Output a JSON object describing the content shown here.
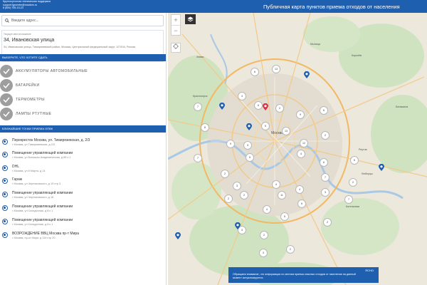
{
  "header": {
    "support_line1": "Круглосуточная техническая поддержка",
    "support_line2": "support.fgrcenter@rosatom.ru",
    "support_line3": "8 (800) 755-15-23",
    "title": "Публичная карта пунктов приема отходов от населения",
    "background": "#1f5fb0"
  },
  "search": {
    "placeholder": "Введите адрес...",
    "value": "",
    "icon": "search-icon"
  },
  "address": {
    "caption": "Текущее местоположение",
    "name": "34, Ивановская улица",
    "full": "34, Ивановская улица, Тимирязевский район, Москва, Центральный федеральный округ, 127434, Россия"
  },
  "waste_section": {
    "title": "ВЫБЕРИТЕ, ЧТО ХОТИТЕ СДАТЬ",
    "items": [
      {
        "label": "АККУМУЛЯТОРЫ АВТОМОБИЛЬНЫЕ",
        "icon": "check-icon"
      },
      {
        "label": "БАТАРЕЙКИ",
        "icon": "check-icon"
      },
      {
        "label": "ТЕРМОМЕТРЫ",
        "icon": "check-icon"
      },
      {
        "label": "ЛАМПЫ РТУТНЫЕ",
        "icon": "check-icon"
      }
    ]
  },
  "points_section": {
    "title": "БЛИЖАЙШИЕ ТОЧКИ ПРИЕМА ОПВК",
    "items": [
      {
        "name": "Перекресток Москва, ул. Тимирязевская, д. 2/3",
        "address": "г Москва, ул Тимирязевская, д 2/3"
      },
      {
        "name": "Помещение управляющей компании",
        "address": "г Москва, ул Большая Академическая, д 85 к 1"
      },
      {
        "name": "DHL",
        "address": "г Москва, ул 8 Марта, д 14"
      },
      {
        "name": "Гараж",
        "address": "г Москва, ул Черняховского, д 19 стр 3"
      },
      {
        "name": "Помещение управляющей компании",
        "address": "г Москва, ул Черняховского, д 16"
      },
      {
        "name": "Помещение управляющей компании",
        "address": "г Москва, ул Складочная, д 8 к 1"
      },
      {
        "name": "Помещение управляющей компании",
        "address": "г Москва, ул Складочная, д 8 к 1"
      },
      {
        "name": "ВОЗРОЖДЕНИЕ ВВЦ Москва пр-т Мира",
        "address": "г Москва, пр-кт Мира, д 119 стр 20"
      }
    ]
  },
  "map": {
    "zoom_in": "+",
    "zoom_out": "−",
    "layers_icon": "layers-icon",
    "locate_icon": "locate-icon",
    "center_label": "Москва",
    "place_labels": [
      "Химки",
      "Мытищи",
      "Королёв",
      "Балашиха",
      "Реутов",
      "Люберцы",
      "Котельники",
      "Красногорск"
    ],
    "clusters": [
      "6",
      "13",
      "4",
      "6",
      "7",
      "2",
      "9",
      "6",
      "2",
      "8",
      "5",
      "13",
      "12",
      "9",
      "3",
      "5",
      "4",
      "6",
      "7",
      "5",
      "2",
      "7",
      "4",
      "4",
      "2",
      "3",
      "3",
      "2",
      "11",
      "2",
      "5",
      "7",
      "4",
      "5",
      "2",
      "3",
      "2",
      "2",
      "3"
    ]
  },
  "notice": {
    "ok": "ЯСНО",
    "text": "Обращаем внимание, что информация по местам приема опасных отходов от населения на данный момент актуализируется."
  }
}
